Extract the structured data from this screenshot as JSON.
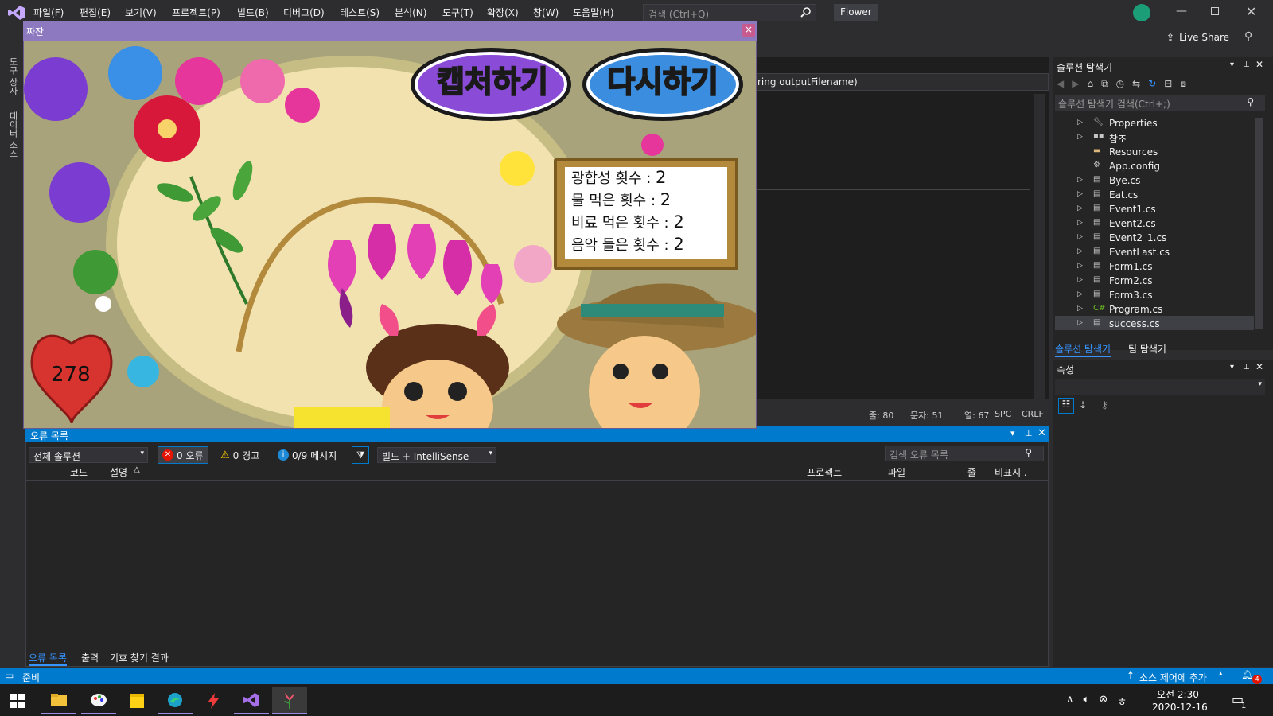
{
  "app": {
    "menu": [
      "파일(F)",
      "편집(E)",
      "보기(V)",
      "프로젝트(P)",
      "빌드(B)",
      "디버그(D)",
      "테스트(S)",
      "분석(N)",
      "도구(T)",
      "확장(X)",
      "창(W)",
      "도움말(H)"
    ],
    "search_placeholder": "검색 (Ctrl+Q)",
    "project_title": "Flower",
    "live_share": "Live Share"
  },
  "left_rail": {
    "items": [
      "도구 상자",
      "데이터 소스"
    ]
  },
  "editor": {
    "code_snippet": "ring outputFilename)",
    "status": {
      "line": "줄: 80",
      "char": "문자: 51",
      "col": "열: 67",
      "spc": "SPC",
      "crlf": "CRLF"
    }
  },
  "game_window": {
    "title": "짜잔",
    "close": "×",
    "capture_button": "캡처하기",
    "retry_button": "다시하기",
    "stats": [
      {
        "label": "광합성 횟수 : ",
        "value": "2"
      },
      {
        "label": "물 먹은 횟수 : ",
        "value": "2"
      },
      {
        "label": "비료 먹은 횟수 : ",
        "value": "2"
      },
      {
        "label": "음악 들은 횟수 : ",
        "value": "2"
      }
    ],
    "heart_value": "278"
  },
  "error_list": {
    "title": "오류 목록",
    "scope": "전체 솔루션",
    "errors": "0 오류",
    "warnings": "0 경고",
    "messages": "0/9 메시지",
    "build_filter": "빌드 + IntelliSense",
    "search_placeholder": "검색 오류 목록",
    "columns": [
      "코드",
      "설명",
      "프로젝트",
      "파일",
      "줄",
      "비표시 ."
    ],
    "bottom_tabs": [
      "오류 목록",
      "출력",
      "기호 찾기 결과"
    ]
  },
  "solution_explorer": {
    "title": "솔루션 탐색기",
    "search_placeholder": "솔루션 탐색기 검색(Ctrl+;)",
    "items": [
      {
        "label": "Properties",
        "icon": "wrench-icon",
        "expandable": true
      },
      {
        "label": "참조",
        "icon": "reference-icon",
        "expandable": true
      },
      {
        "label": "Resources",
        "icon": "folder-icon",
        "expandable": false
      },
      {
        "label": "App.config",
        "icon": "config-icon",
        "expandable": false
      },
      {
        "label": "Bye.cs",
        "icon": "form-icon",
        "expandable": true
      },
      {
        "label": "Eat.cs",
        "icon": "form-icon",
        "expandable": true
      },
      {
        "label": "Event1.cs",
        "icon": "form-icon",
        "expandable": true
      },
      {
        "label": "Event2.cs",
        "icon": "form-icon",
        "expandable": true
      },
      {
        "label": "Event2_1.cs",
        "icon": "form-icon",
        "expandable": true
      },
      {
        "label": "EventLast.cs",
        "icon": "form-icon",
        "expandable": true
      },
      {
        "label": "Form1.cs",
        "icon": "form-icon",
        "expandable": true
      },
      {
        "label": "Form2.cs",
        "icon": "form-icon",
        "expandable": true
      },
      {
        "label": "Form3.cs",
        "icon": "form-icon",
        "expandable": true
      },
      {
        "label": "Program.cs",
        "icon": "csharp-icon",
        "expandable": true
      },
      {
        "label": "success.cs",
        "icon": "form-icon",
        "expandable": true,
        "selected": true
      }
    ],
    "tabs": [
      "솔루션 탐색기",
      "팀 탐색기"
    ]
  },
  "properties": {
    "title": "속성"
  },
  "status_bar": {
    "ready": "준비",
    "source_control": "소스 제어에 추가",
    "notifications": "4"
  },
  "taskbar": {
    "apps": [
      "file-explorer-icon",
      "paint-icon",
      "sticky-notes-icon",
      "edge-icon",
      "flash-icon",
      "visual-studio-icon",
      "flower-app-icon"
    ],
    "time": "오전 2:30",
    "date": "2020-12-16",
    "notification_count": "1"
  },
  "colors": {
    "accent": "#007acc",
    "game_titlebar": "#8d79bf",
    "heart": "#d7332f",
    "capture_button": "#8a4bd6",
    "retry_button": "#3b8de0"
  }
}
